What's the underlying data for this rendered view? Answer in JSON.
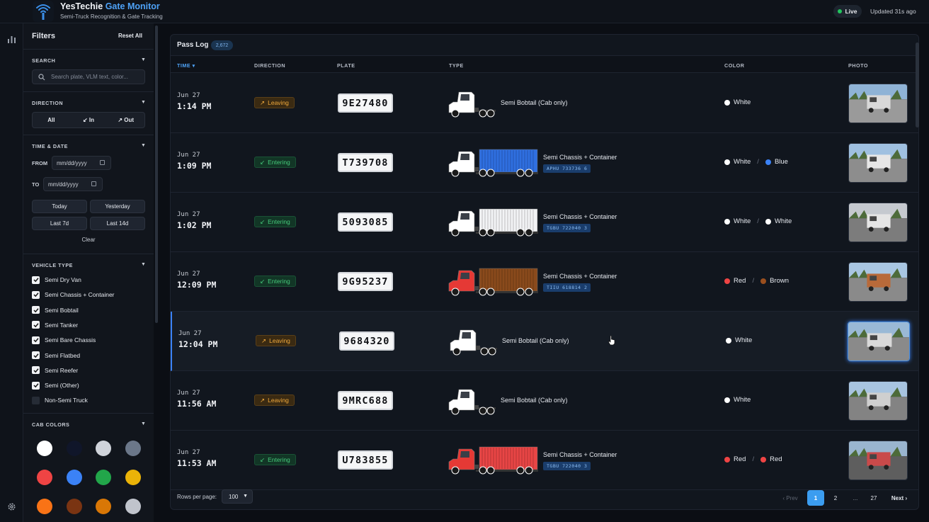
{
  "app": {
    "title_main": "YesTechie ",
    "title_accent": "Gate Monitor",
    "subtitle": "Semi-Truck Recognition & Gate Tracking"
  },
  "status": {
    "live": "Live",
    "updated": "Updated 31s ago"
  },
  "filters": {
    "title": "Filters",
    "reset": "Reset All",
    "search": {
      "heading": "SEARCH",
      "placeholder": "Search plate, VLM text, color..."
    },
    "direction": {
      "heading": "DIRECTION",
      "options": [
        "All",
        "↙ In",
        "↗ Out"
      ]
    },
    "timedate": {
      "heading": "TIME & DATE",
      "from_label": "FROM",
      "to_label": "TO",
      "from_placeholder": "mm/dd/yyyy",
      "to_placeholder": "mm/dd/yyyy",
      "quick": [
        "Today",
        "Yesterday",
        "Last 7d",
        "Last 14d"
      ],
      "clear": "Clear"
    },
    "vehicle_type": {
      "heading": "VEHICLE TYPE",
      "items": [
        {
          "label": "Semi Dry Van",
          "checked": true
        },
        {
          "label": "Semi Chassis + Container",
          "checked": true
        },
        {
          "label": "Semi Bobtail",
          "checked": true
        },
        {
          "label": "Semi Tanker",
          "checked": true
        },
        {
          "label": "Semi Bare Chassis",
          "checked": true
        },
        {
          "label": "Semi Flatbed",
          "checked": true
        },
        {
          "label": "Semi Reefer",
          "checked": true
        },
        {
          "label": "Semi (Other)",
          "checked": true
        },
        {
          "label": "Non-Semi Truck",
          "checked": false
        }
      ]
    },
    "cab_colors": {
      "heading": "CAB COLORS",
      "swatches": [
        "#ffffff",
        "#10162a",
        "#cfd3da",
        "#6b7789",
        "#ef4444",
        "#3b82f6",
        "#22a64a",
        "#eab308",
        "#f97316",
        "#7a3412",
        "#d97706",
        "#c0c4cc"
      ]
    }
  },
  "log": {
    "title": "Pass Log",
    "count": "2,672",
    "columns": {
      "time": "TIME ▾",
      "direction": "DIRECTION",
      "plate": "PLATE",
      "type": "TYPE",
      "color": "COLOR",
      "photo": "PHOTO"
    },
    "rows": [
      {
        "date": "Jun 27",
        "time": "1:14 PM",
        "direction": "Leaving",
        "arrow": "↗",
        "plate": "9E27480",
        "type": "Semi Bobtail (Cab only)",
        "code": "",
        "cab": "#ffffff",
        "container": "",
        "colors": [
          {
            "name": "White",
            "hex": "#ffffff"
          }
        ],
        "photo": "photo-1"
      },
      {
        "date": "Jun 27",
        "time": "1:09 PM",
        "direction": "Entering",
        "arrow": "↙",
        "plate": "T739708",
        "type": "Semi Chassis + Container",
        "code": "APHU 733736 6",
        "cab": "#ffffff",
        "container": "#2f6fe0",
        "colors": [
          {
            "name": "White",
            "hex": "#ffffff"
          },
          {
            "name": "Blue",
            "hex": "#3b82f6"
          }
        ],
        "photo": "photo-2"
      },
      {
        "date": "Jun 27",
        "time": "1:02 PM",
        "direction": "Entering",
        "arrow": "↙",
        "plate": "5093085",
        "type": "Semi Chassis + Container",
        "code": "TGBU 722040 3",
        "cab": "#ffffff",
        "container": "#f2f3f5",
        "colors": [
          {
            "name": "White",
            "hex": "#ffffff"
          },
          {
            "name": "White",
            "hex": "#ffffff"
          }
        ],
        "photo": "photo-3"
      },
      {
        "date": "Jun 27",
        "time": "12:09 PM",
        "direction": "Entering",
        "arrow": "↙",
        "plate": "9G95237",
        "type": "Semi Chassis + Container",
        "code": "TIIU 618814 2",
        "cab": "#e53935",
        "container": "#8a4a1c",
        "colors": [
          {
            "name": "Red",
            "hex": "#ef4444"
          },
          {
            "name": "Brown",
            "hex": "#9a4f1e"
          }
        ],
        "photo": "photo-4"
      },
      {
        "date": "Jun 27",
        "time": "12:04 PM",
        "direction": "Leaving",
        "arrow": "↗",
        "plate": "9684320",
        "type": "Semi Bobtail (Cab only)",
        "code": "",
        "cab": "#ffffff",
        "container": "",
        "colors": [
          {
            "name": "White",
            "hex": "#ffffff"
          }
        ],
        "photo": "photo-5"
      },
      {
        "date": "Jun 27",
        "time": "11:56 AM",
        "direction": "Leaving",
        "arrow": "↗",
        "plate": "9MRC688",
        "type": "Semi Bobtail (Cab only)",
        "code": "",
        "cab": "#ffffff",
        "container": "",
        "colors": [
          {
            "name": "White",
            "hex": "#ffffff"
          }
        ],
        "photo": "photo-6"
      },
      {
        "date": "Jun 27",
        "time": "11:53 AM",
        "direction": "Entering",
        "arrow": "↙",
        "plate": "U783855",
        "type": "Semi Chassis + Container",
        "code": "TGBU 722040 3",
        "cab": "#e53935",
        "container": "#e84545",
        "colors": [
          {
            "name": "Red",
            "hex": "#ef4444"
          },
          {
            "name": "Red",
            "hex": "#ef4444"
          }
        ],
        "photo": "photo-7"
      }
    ]
  },
  "pager": {
    "rows_label": "Rows per page:",
    "rows_value": "100",
    "prev": "‹ Prev",
    "pages": [
      "1",
      "2",
      "...",
      "27"
    ],
    "next": "Next ›",
    "current": "1"
  }
}
